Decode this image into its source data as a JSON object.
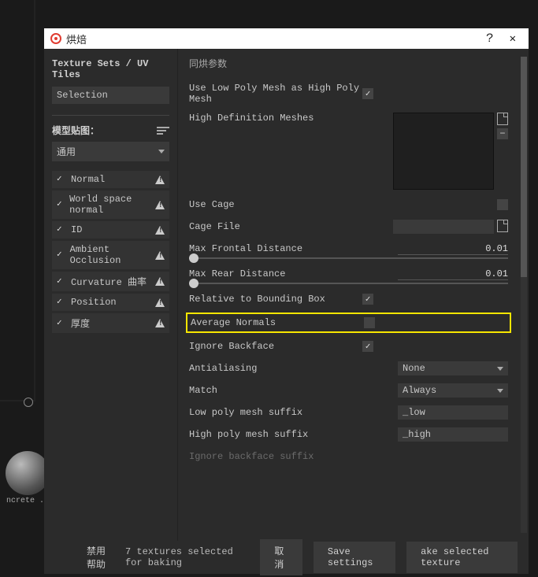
{
  "window": {
    "title": "烘焙",
    "help": "?",
    "close": "✕"
  },
  "left": {
    "tex_sets": "Texture Sets / UV Tiles",
    "selection": "Selection",
    "mesh_maps": "模型贴图：",
    "common": "通用",
    "items": [
      {
        "label": "Normal"
      },
      {
        "label": "World space normal"
      },
      {
        "label": "ID"
      },
      {
        "label": "Ambient Occlusion"
      },
      {
        "label": "Curvature 曲率"
      },
      {
        "label": "Position"
      },
      {
        "label": "厚度"
      }
    ]
  },
  "right": {
    "section": "同烘参数",
    "use_low_as_high": "Use Low Poly Mesh as High Poly Mesh",
    "high_def_meshes": "High Definition Meshes",
    "use_cage": "Use Cage",
    "cage_file": "Cage File",
    "max_frontal": "Max Frontal Distance",
    "max_frontal_val": "0.01",
    "max_rear": "Max Rear Distance",
    "max_rear_val": "0.01",
    "relative_bbox": "Relative to Bounding Box",
    "avg_normals": "Average Normals",
    "ignore_backface": "Ignore Backface",
    "antialiasing": "Antialiasing",
    "antialiasing_val": "None",
    "match": "Match",
    "match_val": "Always",
    "low_suffix": "Low poly mesh suffix",
    "low_suffix_val": "_low",
    "high_suffix": "High poly mesh suffix",
    "high_suffix_val": "_high",
    "ignore_bf_suffix": "Ignore backface suffix"
  },
  "footer": {
    "disable_help": "禁用帮助",
    "selected_info": "7 textures selected for baking",
    "cancel": "取消",
    "save": "Save settings",
    "bake": "ake selected texture"
  },
  "bg": {
    "concrete": "ncrete .."
  }
}
